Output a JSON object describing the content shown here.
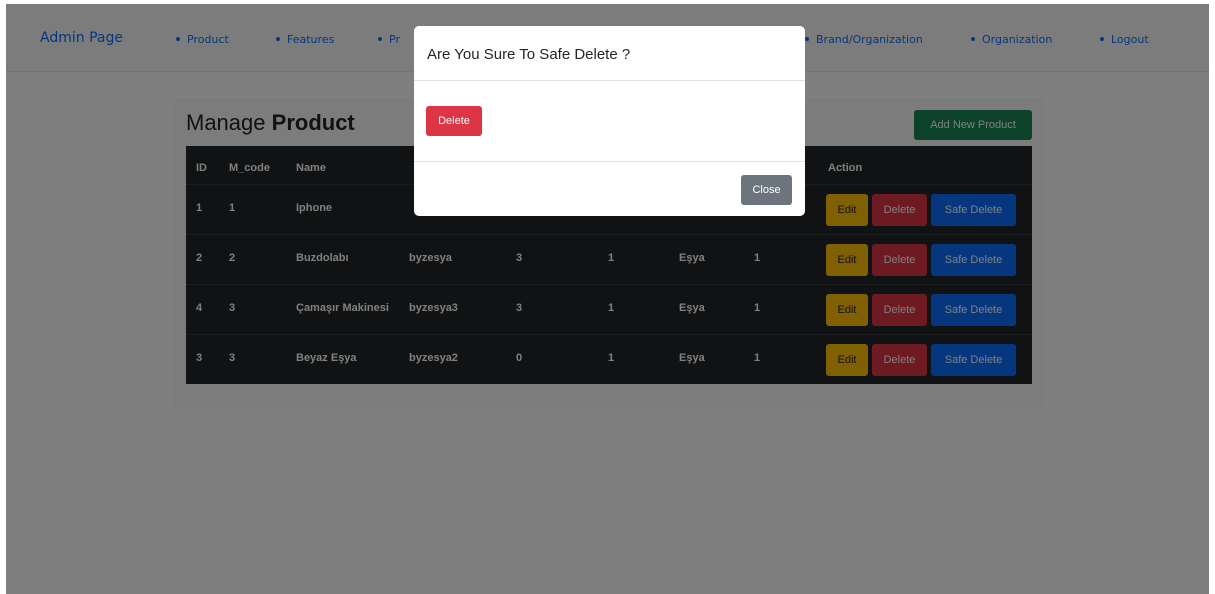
{
  "navbar": {
    "brand": "Admin Page",
    "items": [
      "Product",
      "Features",
      "Pr",
      "Brand/Organization",
      "Organization",
      "Logout"
    ]
  },
  "page": {
    "title_prefix": "Manage",
    "title_bold": "Product",
    "add_button": "Add New Product"
  },
  "table": {
    "headers": {
      "id": "ID",
      "m_code": "M_code",
      "name": "Name",
      "action": "Action"
    },
    "rows": [
      {
        "id": "1",
        "m_code": "1",
        "name": "Iphone",
        "c4": "",
        "c5": "",
        "c6": "",
        "c7": "",
        "c8": ""
      },
      {
        "id": "2",
        "m_code": "2",
        "name": "Buzdolabı",
        "c4": "byzesya",
        "c5": "3",
        "c6": "1",
        "c7": "Eşya",
        "c8": "1"
      },
      {
        "id": "4",
        "m_code": "3",
        "name": "Çamaşır Makinesi",
        "c4": "byzesya3",
        "c5": "3",
        "c6": "1",
        "c7": "Eşya",
        "c8": "1"
      },
      {
        "id": "3",
        "m_code": "3",
        "name": "Beyaz Eşya",
        "c4": "byzesya2",
        "c5": "0",
        "c6": "1",
        "c7": "Eşya",
        "c8": "1"
      }
    ],
    "actions": {
      "edit": "Edit",
      "delete": "Delete",
      "safe_delete": "Safe Delete"
    }
  },
  "modal": {
    "title": "Are You Sure To Safe Delete ?",
    "delete_button": "Delete",
    "close_button": "Close"
  },
  "colors": {
    "primary": "#0d6efd",
    "success": "#198754",
    "danger": "#dc3545",
    "warning": "#ffc107",
    "secondary": "#6c757d",
    "table_dark": "#212529"
  }
}
